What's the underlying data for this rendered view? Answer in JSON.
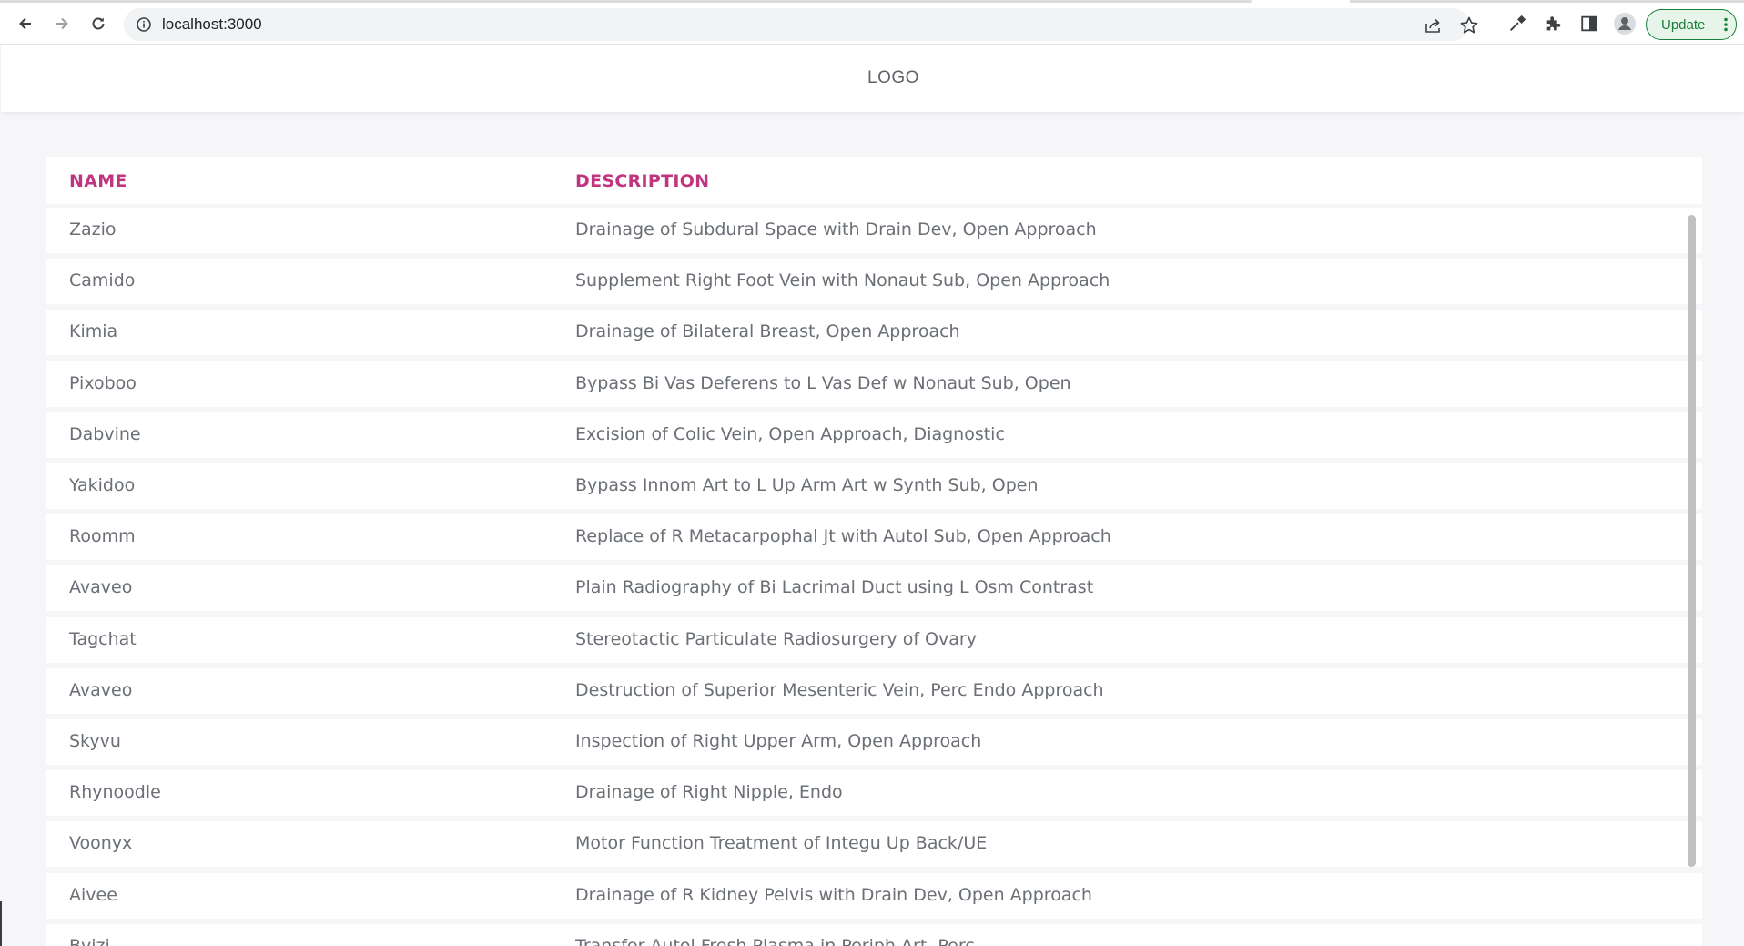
{
  "browser": {
    "url": "localhost:3000",
    "update_label": "Update",
    "icons": {
      "back": "arrow-left-icon",
      "forward": "arrow-right-icon",
      "reload": "reload-icon",
      "site_info": "info-icon",
      "share": "share-icon",
      "bookmark": "star-icon",
      "eyedropper": "eyedropper-icon",
      "extensions": "puzzle-icon",
      "side_panel": "side-panel-icon",
      "profile": "profile-avatar-icon",
      "menu": "kebab-menu-icon"
    }
  },
  "header": {
    "logo": "LOGO"
  },
  "colors": {
    "header_accent": "#c0357f",
    "text": "#6b6f76",
    "update_green": "#188038"
  },
  "table": {
    "columns": [
      "NAME",
      "DESCRIPTION"
    ],
    "rows": [
      {
        "name": "Zazio",
        "description": "Drainage of Subdural Space with Drain Dev, Open Approach"
      },
      {
        "name": "Camido",
        "description": "Supplement Right Foot Vein with Nonaut Sub, Open Approach"
      },
      {
        "name": "Kimia",
        "description": "Drainage of Bilateral Breast, Open Approach"
      },
      {
        "name": "Pixoboo",
        "description": "Bypass Bi Vas Deferens to L Vas Def w Nonaut Sub, Open"
      },
      {
        "name": "Dabvine",
        "description": "Excision of Colic Vein, Open Approach, Diagnostic"
      },
      {
        "name": "Yakidoo",
        "description": "Bypass Innom Art to L Up Arm Art w Synth Sub, Open"
      },
      {
        "name": "Roomm",
        "description": "Replace of R Metacarpophal Jt with Autol Sub, Open Approach"
      },
      {
        "name": "Avaveo",
        "description": "Plain Radiography of Bi Lacrimal Duct using L Osm Contrast"
      },
      {
        "name": "Tagchat",
        "description": "Stereotactic Particulate Radiosurgery of Ovary"
      },
      {
        "name": "Avaveo",
        "description": "Destruction of Superior Mesenteric Vein, Perc Endo Approach"
      },
      {
        "name": "Skyvu",
        "description": "Inspection of Right Upper Arm, Open Approach"
      },
      {
        "name": "Rhynoodle",
        "description": "Drainage of Right Nipple, Endo"
      },
      {
        "name": "Voonyx",
        "description": "Motor Function Treatment of Integu Up Back/UE"
      },
      {
        "name": "Aivee",
        "description": "Drainage of R Kidney Pelvis with Drain Dev, Open Approach"
      },
      {
        "name": "Bvizi",
        "description": "Transfer Autol Fresh Plasma in Periph Art, Perc"
      }
    ]
  }
}
